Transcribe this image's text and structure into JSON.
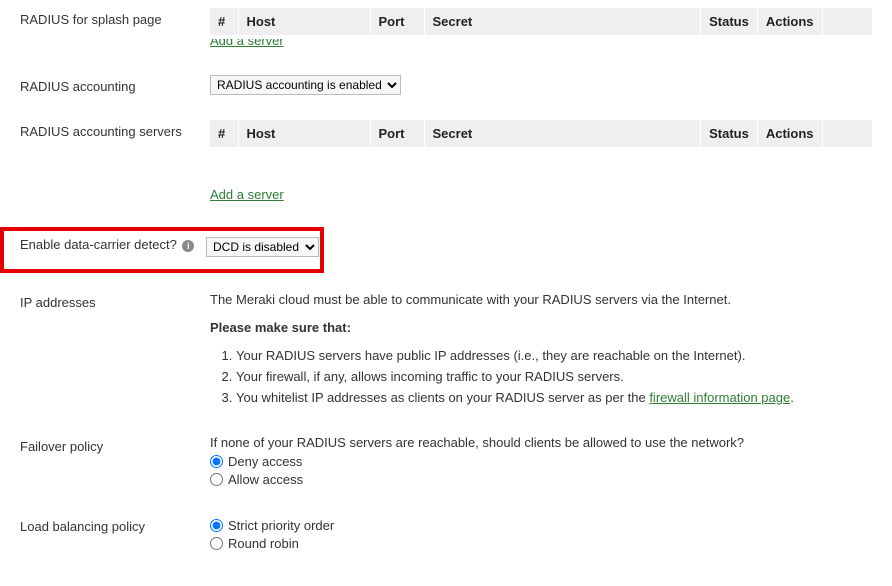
{
  "splash": {
    "label": "RADIUS for splash page",
    "headers": {
      "num": "#",
      "host": "Host",
      "port": "Port",
      "secret": "Secret",
      "status": "Status",
      "actions": "Actions"
    },
    "add_link": "Add a server"
  },
  "accounting": {
    "label": "RADIUS accounting",
    "selected": "RADIUS accounting is enabled"
  },
  "accounting_servers": {
    "label": "RADIUS accounting servers",
    "headers": {
      "num": "#",
      "host": "Host",
      "port": "Port",
      "secret": "Secret",
      "status": "Status",
      "actions": "Actions"
    },
    "add_link": "Add a server"
  },
  "dcd": {
    "label": "Enable data-carrier detect?",
    "selected": "DCD is disabled"
  },
  "ip": {
    "label": "IP addresses",
    "line1": "The Meraki cloud must be able to communicate with your RADIUS servers via the Internet.",
    "bold": "Please make sure that:",
    "li1": "Your RADIUS servers have public IP addresses (i.e., they are reachable on the Internet).",
    "li2": "Your firewall, if any, allows incoming traffic to your RADIUS servers.",
    "li3a": "You whitelist IP addresses as clients on your RADIUS server as per the ",
    "li3link": "firewall information page",
    "li3b": "."
  },
  "failover": {
    "label": "Failover policy",
    "prompt": "If none of your RADIUS servers are reachable, should clients be allowed to use the network?",
    "opt1": "Deny access",
    "opt2": "Allow access"
  },
  "loadbal": {
    "label": "Load balancing policy",
    "opt1": "Strict priority order",
    "opt2": "Round robin"
  }
}
